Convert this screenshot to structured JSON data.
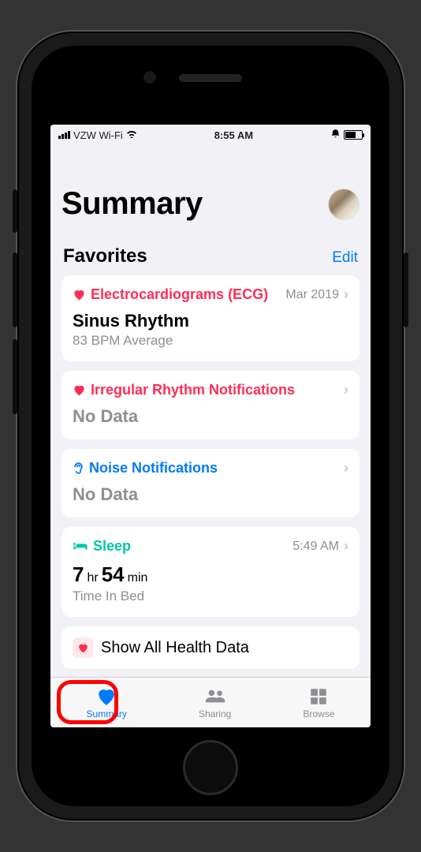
{
  "status_bar": {
    "carrier": "VZW Wi-Fi",
    "time": "8:55 AM"
  },
  "header": {
    "title": "Summary"
  },
  "favorites": {
    "title": "Favorites",
    "edit_label": "Edit"
  },
  "cards": {
    "ecg": {
      "title": "Electrocardiograms (ECG)",
      "timestamp": "Mar 2019",
      "value_main": "Sinus Rhythm",
      "value_sub": "83 BPM Average"
    },
    "irregular": {
      "title": "Irregular Rhythm Notifications",
      "value_main": "No Data"
    },
    "noise": {
      "title": "Noise Notifications",
      "value_main": "No Data"
    },
    "sleep": {
      "title": "Sleep",
      "timestamp": "5:49 AM",
      "hours": "7",
      "hours_unit": "hr",
      "minutes": "54",
      "minutes_unit": "min",
      "value_sub": "Time In Bed"
    },
    "show_all": {
      "label": "Show All Health Data"
    }
  },
  "tabs": {
    "summary": "Summary",
    "sharing": "Sharing",
    "browse": "Browse"
  }
}
